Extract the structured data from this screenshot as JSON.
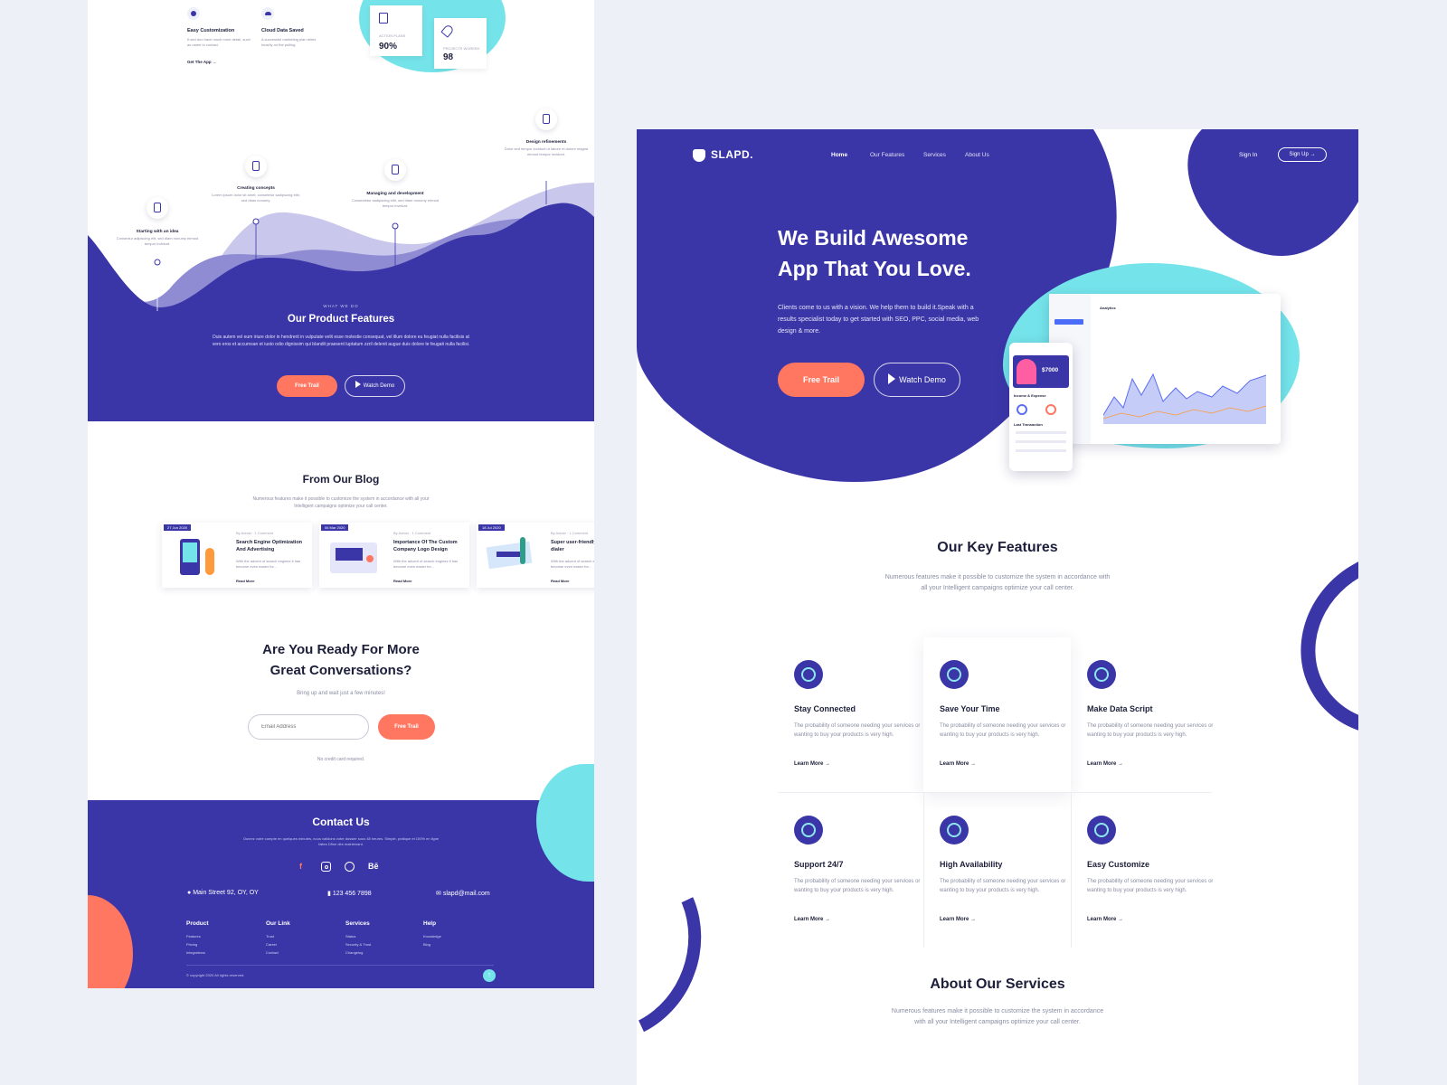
{
  "left": {
    "top_features": [
      {
        "title": "Easy Customization",
        "desc": "It sed duo have much more detail, such as name to contact."
      },
      {
        "title": "Cloud Data Saved",
        "desc": "A successful marketing plan relies heavily on the pulling."
      }
    ],
    "get_app": "Get The App",
    "stat_cards": [
      {
        "label": "ACTION PLANS",
        "value": "90%"
      },
      {
        "label": "PROJECTS WORKED",
        "value": "98"
      }
    ],
    "milestones": [
      {
        "title": "Starting with an idea",
        "desc": "Consectur adipiscing elit, sed diam nonumy eirmod tempor invidunt."
      },
      {
        "title": "Creating concepts",
        "desc": "Lorem ipsum dolor sit amet, consetetur sadipscing elitr, sed diam nonumy."
      },
      {
        "title": "Managing and development",
        "desc": "Consectetur sadipscing elitr, sed diam nonumy eirmod tempor invidunt."
      },
      {
        "title": "Design refinements",
        "desc": "Dolor sed tempor invidunt ut labore et dolore magna eirmod tempor invidunt."
      }
    ],
    "product": {
      "eyebrow": "WHAT WE DO",
      "title": "Our Product Features",
      "desc": "Duis autem vel eum iriure dolor in hendrerit in vulputate velit esse molestie consequat, vel illum dolore eu feugiat nulla facilisis at vero eros et accumsan et iusto odio dignissim qui blandit praesent luptatum zzril delenit augue duis dolore te feugait nulla facilisi.",
      "free_trail": "Free Trail",
      "watch_demo": "Watch Demo"
    },
    "blog": {
      "title": "From Our Blog",
      "desc": "Numerous features make it possible to customize the system in accordance with all your Intelligent campaigns optimize your call center.",
      "posts": [
        {
          "date": "27 Jun 2020",
          "meta": "By Admin  ·  1 Comment",
          "title": "Search Engine Optimization And Advertising",
          "desc": "With the advent of search engines it has become even easier for...",
          "more": "Read More"
        },
        {
          "date": "06 Mar 2020",
          "meta": "By Admin  ·  1 Comment",
          "title": "Importance Of The Custom Company Logo Design",
          "desc": "With the advent of search engines it has become even easier for...",
          "more": "Read More"
        },
        {
          "date": "18 Jul 2020",
          "meta": "By Admin  ·  1 Comment",
          "title": "Super user-friendly really good dialer",
          "desc": "With the advent of search engines it has become even easier for...",
          "more": "Read More"
        }
      ]
    },
    "cta": {
      "title_line1": "Are You Ready For More",
      "title_line2": "Great Conversations?",
      "sub": "Bring up and wait just a few minutes!",
      "email_placeholder": "Email Address",
      "button": "Free Trail",
      "note": "No credit card required."
    },
    "contact": {
      "title": "Contact Us",
      "desc": "Ouvrez votre compte en quelques minutes, nous validons votre dossier sous 48 heures. Simple, pratique et 100% en ligne faites Dfine dès maintenant.",
      "social_behance": "Bē",
      "address": "Main Street 92, OY, OY",
      "phone": "123 456 7898",
      "email": "slapd@mail.com"
    },
    "footer_cols": [
      {
        "heading": "Product",
        "items": [
          "Features",
          "Pricing",
          "Integrations"
        ]
      },
      {
        "heading": "Our Link",
        "items": [
          "Trust",
          "Career",
          "Contact"
        ]
      },
      {
        "heading": "Services",
        "items": [
          "Status",
          "Security & Trust",
          "Changelog"
        ]
      },
      {
        "heading": "Help",
        "items": [
          "Knowledge",
          "Blog"
        ]
      }
    ],
    "copyright": "© copyright 2020 All rights reserved."
  },
  "right": {
    "brand": "SLAPD.",
    "nav": [
      "Home",
      "Our Features",
      "Services",
      "About Us"
    ],
    "sign_in": "Sign In",
    "sign_up": "Sign Up",
    "hero_title_line1": "We Build Awesome",
    "hero_title_line2": "App That You Love.",
    "hero_desc": "Clients come to us with a vision. We help them to build it.Speak with a results specialist today to get started with SEO, PPC, social media, web design & more.",
    "free_trail": "Free Trail",
    "watch_demo": "Watch Demo",
    "mockup": {
      "analytics": "Analytics",
      "amount": "$7000",
      "income": "Income & Expense",
      "last_tx": "Last Transaction"
    },
    "key_features": {
      "title": "Our Key Features",
      "desc_line1": "Numerous features make it possible to customize the system in accordance with",
      "desc_line2": "all your Intelligent campaigns optimize your call center.",
      "items": [
        {
          "title": "Stay Connected",
          "desc": "The probability of someone needing your services or wanting to buy your products is very high.",
          "more": "Learn More"
        },
        {
          "title": "Save Your Time",
          "desc": "The probability of someone needing your services or wanting to buy your products is very high.",
          "more": "Learn More"
        },
        {
          "title": "Make Data Script",
          "desc": "The probability of someone needing your services or wanting to buy your products is very high.",
          "more": "Learn More"
        },
        {
          "title": "Support 24/7",
          "desc": "The probability of someone needing your services or wanting to buy your products is very high.",
          "more": "Learn More"
        },
        {
          "title": "High Availability",
          "desc": "The probability of someone needing your services or wanting to buy your products is very high.",
          "more": "Learn More"
        },
        {
          "title": "Easy Customize",
          "desc": "The probability of someone needing your services or wanting to buy your products is very high.",
          "more": "Learn More"
        }
      ]
    },
    "about": {
      "title": "About Our Services",
      "desc_line1": "Numerous features make it possible to customize the system in accordance",
      "desc_line2": "with all your Intelligent campaigns optimize your call center."
    }
  },
  "colors": {
    "primary": "#3a36a8",
    "accent": "#ff7661",
    "cyan": "#74e4ea"
  }
}
